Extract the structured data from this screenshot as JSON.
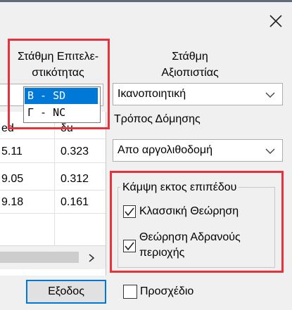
{
  "window": {
    "close_icon": "close-x-icon"
  },
  "performance_level": {
    "label_line1": "Στάθμη Επιτελε-",
    "label_line2": "στικότητας",
    "options": [
      {
        "label": "B - SD",
        "selected": true
      },
      {
        "label": "Γ - NC",
        "selected": false
      }
    ]
  },
  "reliability_level": {
    "label_line1": "Στάθμη",
    "label_line2": "Αξιοπιστίας",
    "selected_value": "Ικανοποιητική"
  },
  "construction_method": {
    "label": "Τρόπος Δόμησης",
    "selected_value": "Απο αργολιθοδομή"
  },
  "results_table": {
    "headers": [
      "ed",
      "δu"
    ],
    "rows": [
      [
        "5.11",
        "0.323"
      ],
      [
        "9.05",
        "0.312"
      ],
      [
        "9.18",
        "0.161"
      ]
    ],
    "scroll_right_icon": "chevron-right-icon"
  },
  "out_of_plane_bending": {
    "title": "Κάμψη εκτος επιπέδου",
    "options": [
      {
        "label": "Κλασσική Θεώρηση",
        "checked": true
      },
      {
        "label_line1": "Θεώρηση Αδρανούς",
        "label_line2": "περιοχής",
        "checked": true
      }
    ]
  },
  "exit_button": {
    "label": "Εξοδος"
  },
  "draft_checkbox": {
    "label": "Προσχέδιο",
    "checked": false
  },
  "colors": {
    "highlight_red": "#e5323c",
    "selection_blue": "#0078d7",
    "background": "#f0f0f0"
  }
}
